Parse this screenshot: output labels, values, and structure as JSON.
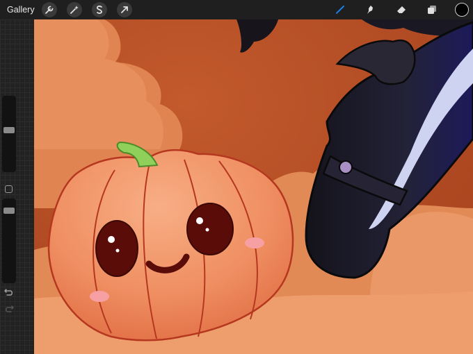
{
  "toolbar": {
    "gallery_label": "Gallery",
    "left_tools": [
      "wrench-icon",
      "magic-wand-icon",
      "selection-icon",
      "transform-arrow-icon"
    ],
    "right_tools": [
      "brush-icon",
      "smudge-icon",
      "eraser-icon",
      "layers-icon"
    ],
    "active_tool": "brush-icon",
    "active_color": "#1a7fe8",
    "current_color": "#000000"
  },
  "sidebar": {
    "controls": [
      "brush-size-slider",
      "modify-button",
      "opacity-slider",
      "undo-icon",
      "redo-icon"
    ]
  },
  "canvas": {
    "palette": {
      "background": "#c9582a",
      "clouds": "#e48a56",
      "pumpkin": "#ef8f62",
      "outline": "#b6371f",
      "stem": "#8fd05a",
      "eyes": "#5a0d08",
      "blush": "#f7a0a3",
      "hat": "#1d1b25",
      "band": "#a88fc4"
    }
  }
}
